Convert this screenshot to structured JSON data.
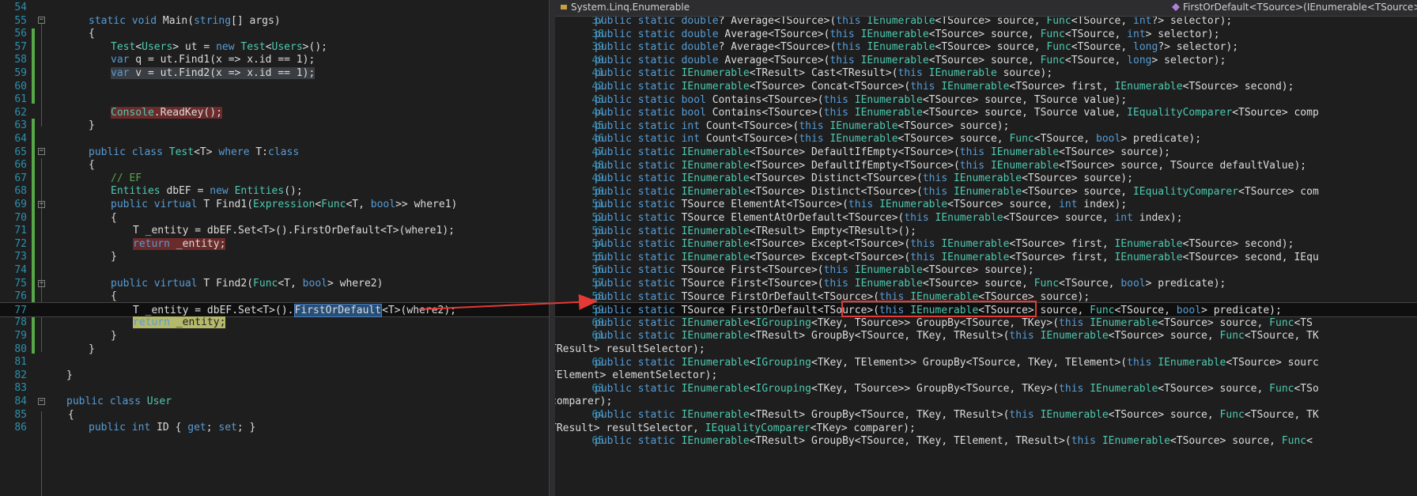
{
  "left_editor": {
    "lines": [
      {
        "n": "54",
        "code": ""
      },
      {
        "n": "55",
        "code": "static void Main(string[] args)"
      },
      {
        "n": "56",
        "code": "{"
      },
      {
        "n": "57",
        "code": "Test<Users> ut = new Test<Users>();"
      },
      {
        "n": "58",
        "code": "var q = ut.Find1(x => x.id == 1);"
      },
      {
        "n": "59",
        "code": "var v = ut.Find2(x => x.id == 1);"
      },
      {
        "n": "60",
        "code": ""
      },
      {
        "n": "61",
        "code": ""
      },
      {
        "n": "62",
        "code": "Console.ReadKey();"
      },
      {
        "n": "63",
        "code": "}"
      },
      {
        "n": "64",
        "code": ""
      },
      {
        "n": "65",
        "code": "public class Test<T> where T:class"
      },
      {
        "n": "66",
        "code": "{"
      },
      {
        "n": "67",
        "code": "// EF"
      },
      {
        "n": "68",
        "code": "Entities dbEF = new Entities();"
      },
      {
        "n": "69",
        "code": "public virtual T Find1(Expression<Func<T, bool>> where1)"
      },
      {
        "n": "70",
        "code": "{"
      },
      {
        "n": "71",
        "code": "T _entity = dbEF.Set<T>().FirstOrDefault<T>(where1);"
      },
      {
        "n": "72",
        "code": "return _entity;"
      },
      {
        "n": "73",
        "code": "}"
      },
      {
        "n": "74",
        "code": ""
      },
      {
        "n": "75",
        "code": "public virtual T Find2(Func<T, bool> where2)"
      },
      {
        "n": "76",
        "code": "{"
      },
      {
        "n": "77",
        "code": "T _entity = dbEF.Set<T>().FirstOrDefault<T>(where2);"
      },
      {
        "n": "78",
        "code": "return _entity;"
      },
      {
        "n": "79",
        "code": "}"
      },
      {
        "n": "80",
        "code": "}"
      },
      {
        "n": "81",
        "code": ""
      },
      {
        "n": "82",
        "code": "}"
      },
      {
        "n": "83",
        "code": ""
      },
      {
        "n": "84",
        "code": "public class User"
      },
      {
        "n": "85",
        "code": "{"
      },
      {
        "n": "86",
        "code": "public int ID { get; set; }"
      }
    ]
  },
  "right_editor": {
    "tab_title": "System.Linq.Enumerable",
    "member_dropdown": "FirstOrDefault<TSource>(IEnumerable<TSource> s",
    "lines": [
      {
        "n": "37",
        "code": "public static double? Average<TSource>(this IEnumerable<TSource> source, Func<TSource, int?> selector);"
      },
      {
        "n": "38",
        "code": "public static double Average<TSource>(this IEnumerable<TSource> source, Func<TSource, int> selector);"
      },
      {
        "n": "39",
        "code": "public static double? Average<TSource>(this IEnumerable<TSource> source, Func<TSource, long?> selector);"
      },
      {
        "n": "40",
        "code": "public static double Average<TSource>(this IEnumerable<TSource> source, Func<TSource, long> selector);"
      },
      {
        "n": "41",
        "code": "public static IEnumerable<TResult> Cast<TResult>(this IEnumerable source);"
      },
      {
        "n": "42",
        "code": "public static IEnumerable<TSource> Concat<TSource>(this IEnumerable<TSource> first, IEnumerable<TSource> second);"
      },
      {
        "n": "43",
        "code": "public static bool Contains<TSource>(this IEnumerable<TSource> source, TSource value);"
      },
      {
        "n": "44",
        "code": "public static bool Contains<TSource>(this IEnumerable<TSource> source, TSource value, IEqualityComparer<TSource> comp"
      },
      {
        "n": "45",
        "code": "public static int Count<TSource>(this IEnumerable<TSource> source);"
      },
      {
        "n": "46",
        "code": "public static int Count<TSource>(this IEnumerable<TSource> source, Func<TSource, bool> predicate);"
      },
      {
        "n": "47",
        "code": "public static IEnumerable<TSource> DefaultIfEmpty<TSource>(this IEnumerable<TSource> source);"
      },
      {
        "n": "48",
        "code": "public static IEnumerable<TSource> DefaultIfEmpty<TSource>(this IEnumerable<TSource> source, TSource defaultValue);"
      },
      {
        "n": "49",
        "code": "public static IEnumerable<TSource> Distinct<TSource>(this IEnumerable<TSource> source);"
      },
      {
        "n": "50",
        "code": "public static IEnumerable<TSource> Distinct<TSource>(this IEnumerable<TSource> source, IEqualityComparer<TSource> com"
      },
      {
        "n": "51",
        "code": "public static TSource ElementAt<TSource>(this IEnumerable<TSource> source, int index);"
      },
      {
        "n": "52",
        "code": "public static TSource ElementAtOrDefault<TSource>(this IEnumerable<TSource> source, int index);"
      },
      {
        "n": "53",
        "code": "public static IEnumerable<TResult> Empty<TResult>();"
      },
      {
        "n": "54",
        "code": "public static IEnumerable<TSource> Except<TSource>(this IEnumerable<TSource> first, IEnumerable<TSource> second);"
      },
      {
        "n": "55",
        "code": "public static IEnumerable<TSource> Except<TSource>(this IEnumerable<TSource> first, IEnumerable<TSource> second, IEqu"
      },
      {
        "n": "56",
        "code": "public static TSource First<TSource>(this IEnumerable<TSource> source);"
      },
      {
        "n": "57",
        "code": "public static TSource First<TSource>(this IEnumerable<TSource> source, Func<TSource, bool> predicate);"
      },
      {
        "n": "58",
        "code": "public static TSource FirstOrDefault<TSource>(this IEnumerable<TSource> source);"
      },
      {
        "n": "59",
        "code": "public static TSource FirstOrDefault<TSource>(this IEnumerable<TSource> source, Func<TSource, bool> predicate);"
      },
      {
        "n": "60",
        "code": "public static IEnumerable<IGrouping<TKey, TSource>> GroupBy<TSource, TKey>(this IEnumerable<TSource> source, Func<TS"
      },
      {
        "n": "61",
        "code": "public static IEnumerable<TResult> GroupBy<TSource, TKey, TResult>(this IEnumerable<TSource> source, Func<TSource, TK"
      },
      {
        "n": "61w",
        "code": "TResult> resultSelector);"
      },
      {
        "n": "62",
        "code": "public static IEnumerable<IGrouping<TKey, TElement>> GroupBy<TSource, TKey, TElement>(this IEnumerable<TSource> sourc"
      },
      {
        "n": "62w",
        "code": "TElement> elementSelector);"
      },
      {
        "n": "63",
        "code": "public static IEnumerable<IGrouping<TKey, TSource>> GroupBy<TSource, TKey>(this IEnumerable<TSource> source, Func<TSo"
      },
      {
        "n": "63w",
        "code": "comparer);"
      },
      {
        "n": "64",
        "code": "public static IEnumerable<TResult> GroupBy<TSource, TKey, TResult>(this IEnumerable<TSource> source, Func<TSource, TK"
      },
      {
        "n": "64w",
        "code": "TResult> resultSelector, IEqualityComparer<TKey> comparer);"
      },
      {
        "n": "65",
        "code": "public static IEnumerable<TResult> GroupBy<TSource, TKey, TElement, TResult>(this IEnumerable<TSource> source, Func<"
      }
    ]
  },
  "colors": {
    "background": "#1e1e1e",
    "keyword": "#569cd6",
    "type": "#4ec9b0",
    "comment": "#57a64a",
    "line_number": "#2b91af",
    "annotation": "#e53935"
  }
}
